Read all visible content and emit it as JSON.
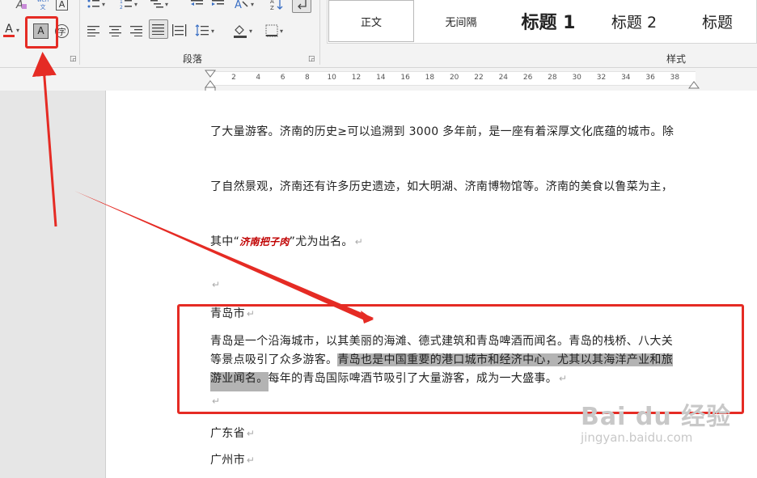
{
  "ribbon": {
    "font_color_icon": "A",
    "char_shading_icon": "A",
    "enclose_char_icon": "字",
    "phonetic_icon": "wén 文",
    "border_char_icon": "A",
    "paragraph_label": "段落",
    "styles_label": "样式"
  },
  "styles": [
    {
      "label": "正文"
    },
    {
      "label": "无间隔"
    },
    {
      "label": "标题 1"
    },
    {
      "label": "标题 2"
    },
    {
      "label": "标题"
    }
  ],
  "ruler": {
    "ticks": [
      "2",
      "4",
      "6",
      "8",
      "10",
      "12",
      "14",
      "16",
      "18",
      "20",
      "22",
      "24",
      "26",
      "28",
      "30",
      "32",
      "34",
      "36",
      "38"
    ]
  },
  "document": {
    "line1": "了大量游客。济南的历史≥可以追溯到 3000 多年前，是一座有着深厚文化底蕴的城市。除",
    "line2": "了自然景观，济南还有许多历史遗迹，如大明湖、济南博物馆等。济南的美食以鲁菜为主，",
    "line3_prefix": "其中“",
    "line3_emph": "济南把子肉",
    "line3_suffix": "”尤为出名。",
    "qingdao_heading": "青岛市",
    "qd_line1": "青岛是一个沿海城市，以其美丽的海滩、德式建筑和青岛啤酒而闻名。青岛的栈桥、八大关",
    "qd_line2_plain": "等景点吸引了众多游客。",
    "qd_line2_hl": "青岛也是中国重要的港口城市和经济中心，尤其以其海洋产业和旅",
    "qd_line3_hl": "游业闻名。",
    "qd_line3_plain": "每年的青岛国际啤酒节吸引了大量游客，成为一大盛事。",
    "guangdong": "广东省",
    "guangzhou": "广州市",
    "para_mark": "↵"
  },
  "watermark": {
    "main": "Bai du 经验",
    "sub": "jingyan.baidu.com"
  },
  "colors": {
    "annotation_red": "#e52b24",
    "shading_gray": "#b3b3b3"
  }
}
